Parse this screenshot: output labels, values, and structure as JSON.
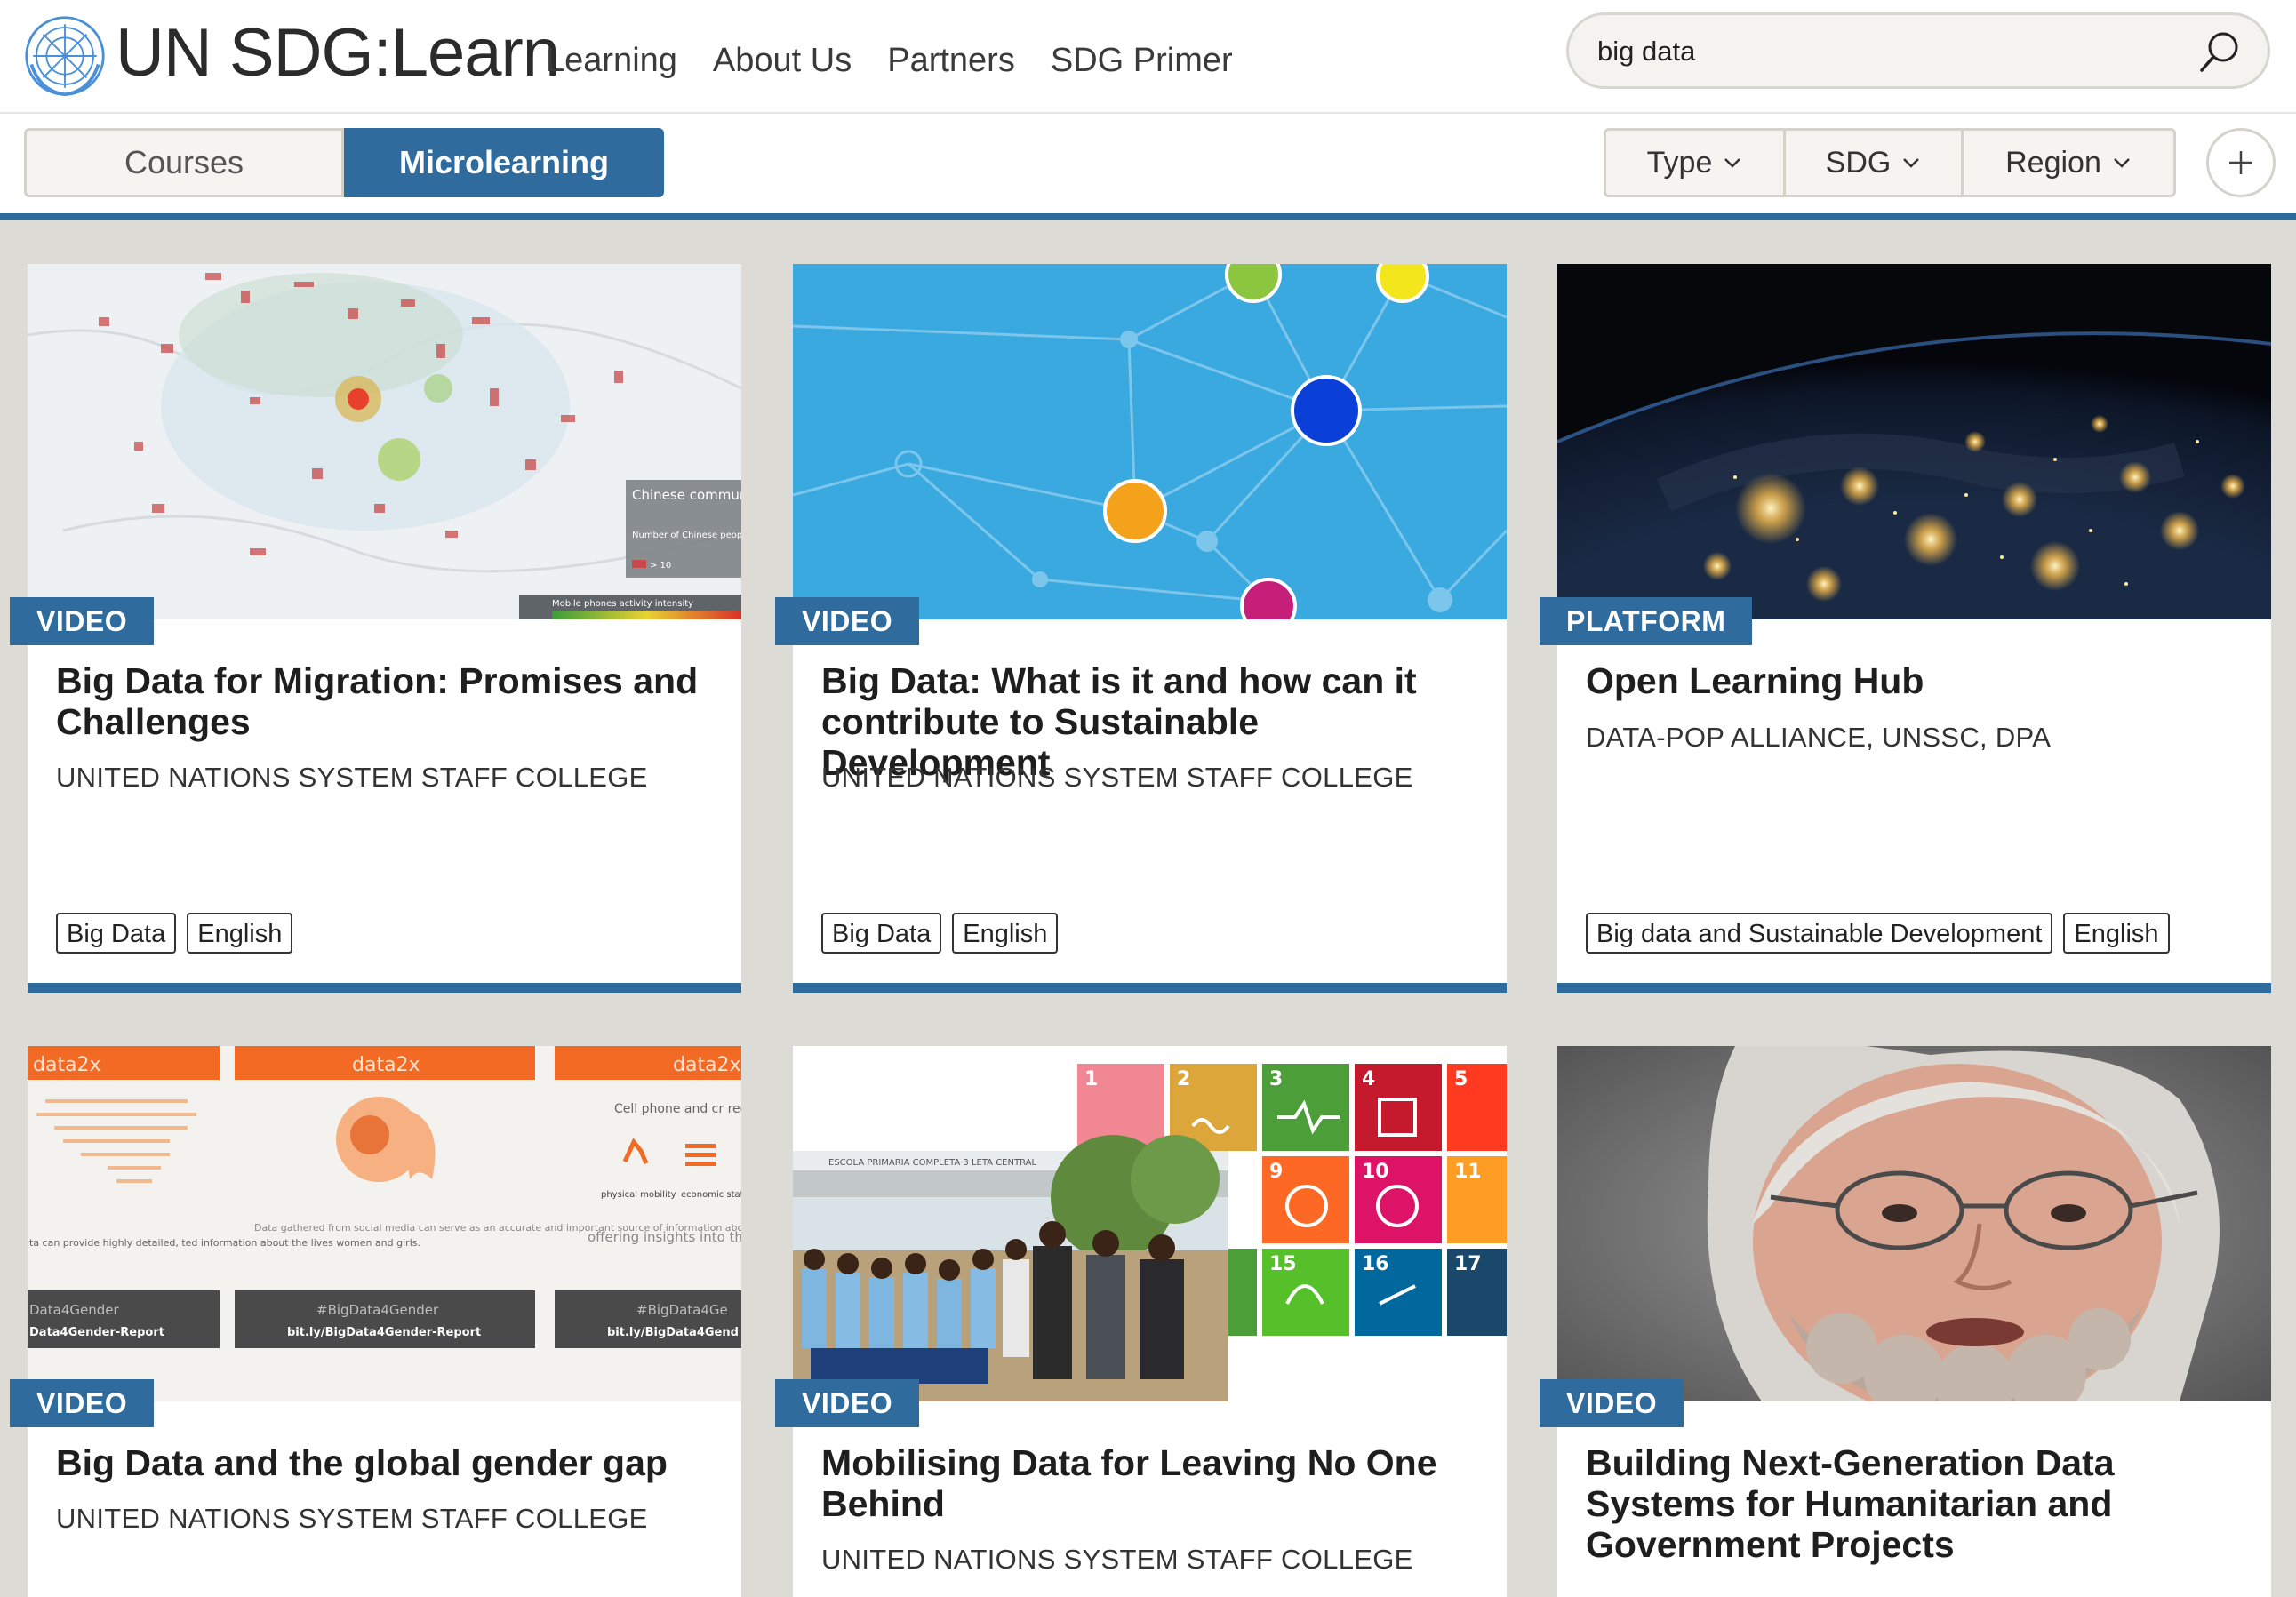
{
  "header": {
    "brand": "UN SDG:Learn",
    "nav": [
      "Learning",
      "About Us",
      "Partners",
      "SDG Primer"
    ],
    "search_value": "big data"
  },
  "filters": {
    "tabs": [
      "Courses",
      "Microlearning"
    ],
    "active_tab": "Microlearning",
    "dropdowns": [
      "Type",
      "SDG",
      "Region"
    ]
  },
  "cards": [
    {
      "type": "VIDEO",
      "title": "Big Data for Migration: Promises and Challenges",
      "org": "UNITED NATIONS SYSTEM STAFF COLLEGE",
      "tags": [
        "Big Data",
        "English"
      ],
      "thumb_legend": {
        "title": "Chinese communities",
        "subtitle": "Number of Chinese people per census area",
        "value": "> 10",
        "bar_label": "Mobile phones activity intensity"
      }
    },
    {
      "type": "VIDEO",
      "title": "Big Data: What is it and how can it contribute to Sustainable Development",
      "org": "UNITED NATIONS SYSTEM STAFF COLLEGE",
      "tags": [
        "Big Data",
        "English"
      ]
    },
    {
      "type": "PLATFORM",
      "title": "Open Learning Hub",
      "org": "DATA-POP ALLIANCE, UNSSC, DPA",
      "tags": [
        "Big data and Sustainable Development",
        "English"
      ]
    },
    {
      "type": "VIDEO",
      "title": "Big Data and the global gender gap",
      "org": "UNITED NATIONS SYSTEM STAFF COLLEGE",
      "thumb_text": {
        "brand": "data2x",
        "left_caption": "ta can provide highly detailed, ted information about the lives women and girls.",
        "center_caption": "Data gathered from social media can serve as an accurate and important source of information about the mental health of women and girls.",
        "right_caption": "offering insights into the priorities of women",
        "right_header": "Cell phone and cr records can re",
        "icon_labels": [
          "physical mobility",
          "economic status"
        ],
        "hashtag": "#BigData4Gender",
        "left_hashtag": "Data4Gender",
        "link": "bit.ly/BigData4Gender-Report",
        "left_link": "Data4Gender-Report",
        "right_hashtag": "#BigData4Ge",
        "right_link": "bit.ly/BigData4Gend"
      }
    },
    {
      "type": "VIDEO",
      "title": "Mobilising Data for Leaving No One Behind",
      "org": "UNITED NATIONS SYSTEM STAFF COLLEGE",
      "thumb_text": {
        "school_sign": "ESCOLA PRIMARIA COMPLETA 3 LETA CENTRAL",
        "sdg_numbers": [
          "1",
          "2",
          "3",
          "4",
          "5",
          "9",
          "10",
          "11",
          "15",
          "16",
          "17"
        ]
      }
    },
    {
      "type": "VIDEO",
      "title": "Building Next-Generation Data Systems for Humanitarian and Government Projects",
      "org": ""
    }
  ],
  "colors": {
    "accent": "#2f6c9d",
    "background": "#dddbd6",
    "sdg": [
      "#e5243b",
      "#dda63a",
      "#4c9f38",
      "#c5192d",
      "#ff3a21",
      "#fd6925",
      "#dd1367",
      "#fd9d24",
      "#56c02b",
      "#00689d",
      "#19486a"
    ]
  }
}
